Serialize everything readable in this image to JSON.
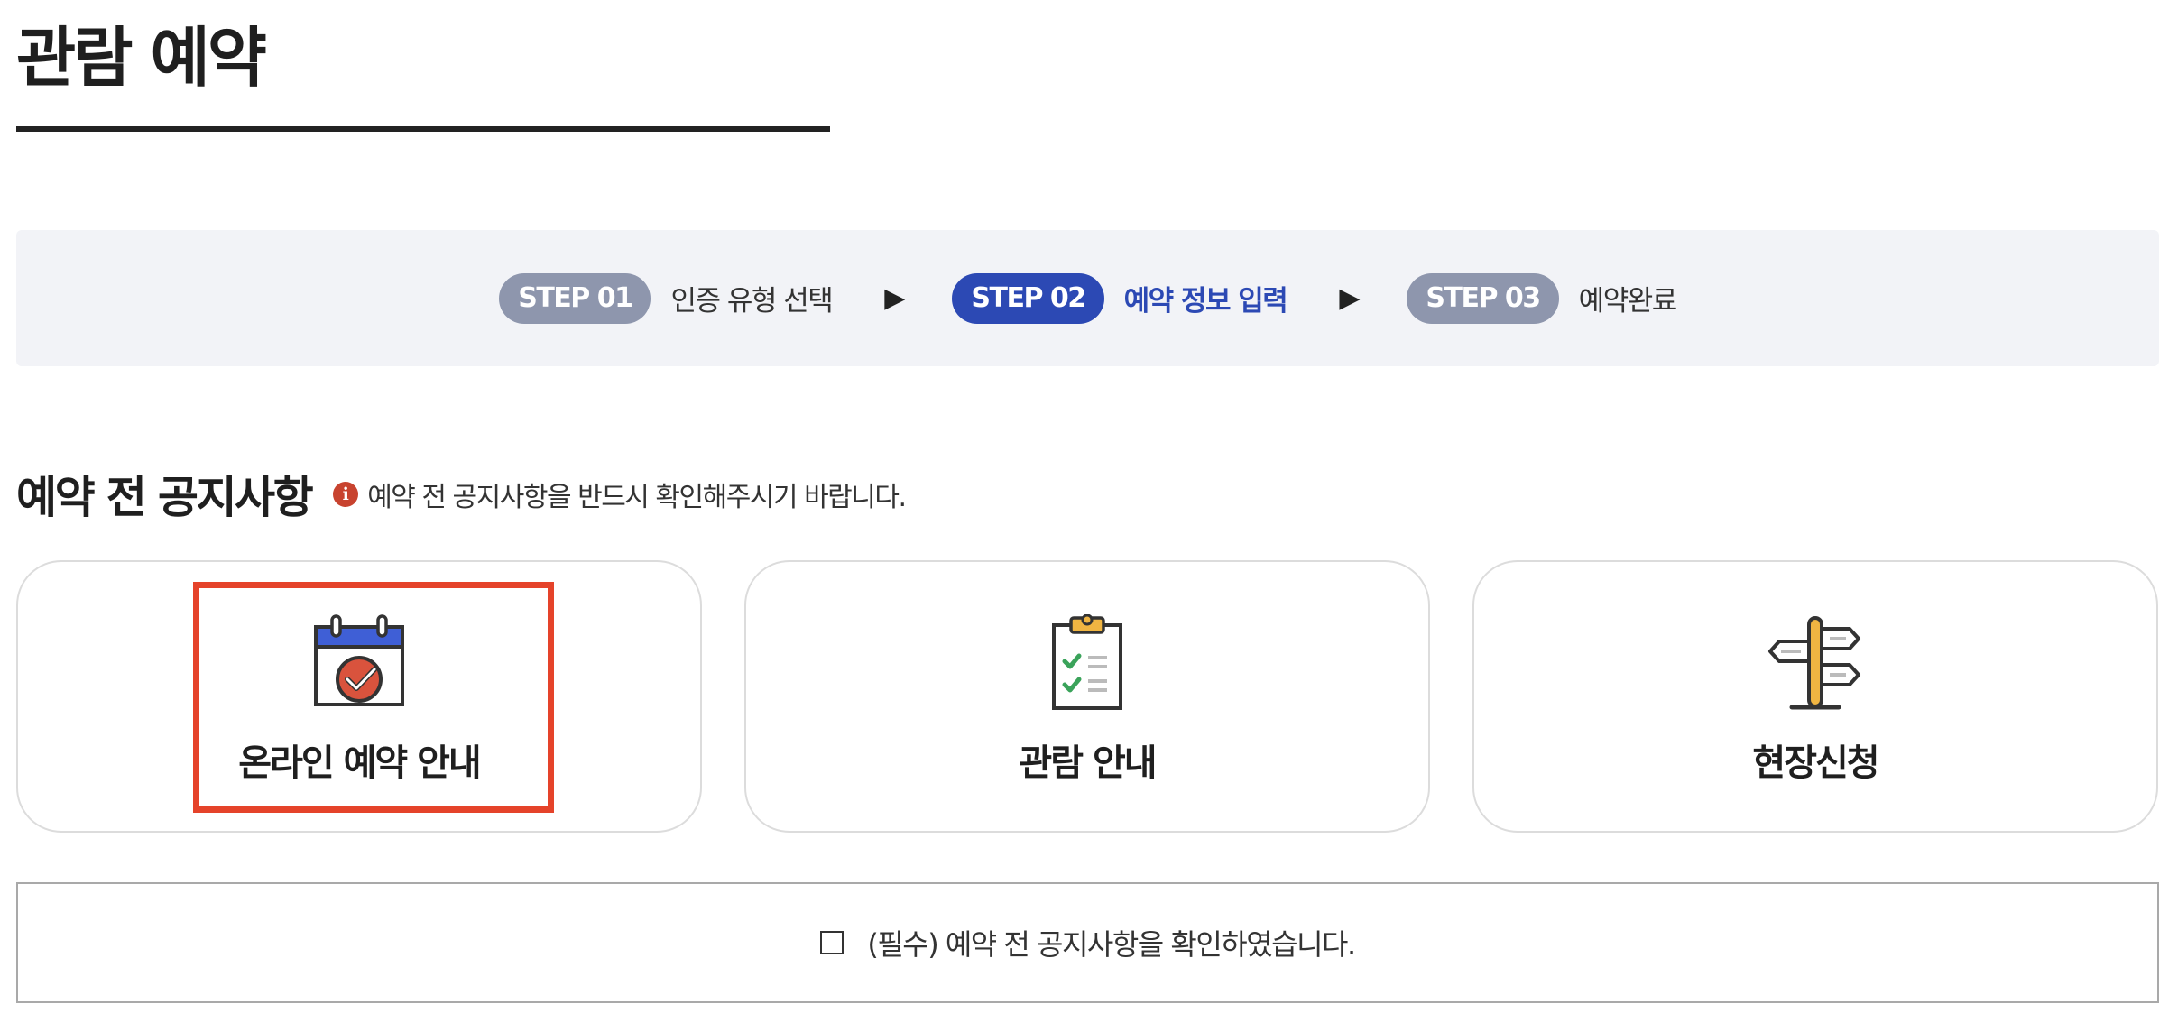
{
  "page": {
    "title": "관람 예약"
  },
  "steps": [
    {
      "badge": "STEP 01",
      "label": "인증 유형 선택",
      "active": false
    },
    {
      "badge": "STEP 02",
      "label": "예약 정보 입력",
      "active": true
    },
    {
      "badge": "STEP 03",
      "label": "예약완료",
      "active": false
    }
  ],
  "step_arrow": "▶",
  "notice": {
    "heading": "예약 전 공지사항",
    "info_icon": "i",
    "message": "예약 전 공지사항을 반드시 확인해주시기 바랍니다."
  },
  "cards": [
    {
      "label": "온라인 예약 안내",
      "icon": "calendar-check-icon",
      "highlighted": true
    },
    {
      "label": "관람 안내",
      "icon": "clipboard-checklist-icon",
      "highlighted": false
    },
    {
      "label": "현장신청",
      "icon": "signpost-icon",
      "highlighted": false
    }
  ],
  "confirm": {
    "label": "(필수) 예약 전 공지사항을 확인하였습니다.",
    "checked": false
  },
  "colors": {
    "step_active": "#2c49b4",
    "step_inactive": "#8e96ad",
    "highlight": "#e5432a",
    "info_icon": "#c8432f",
    "steps_background": "#f2f3f7"
  }
}
